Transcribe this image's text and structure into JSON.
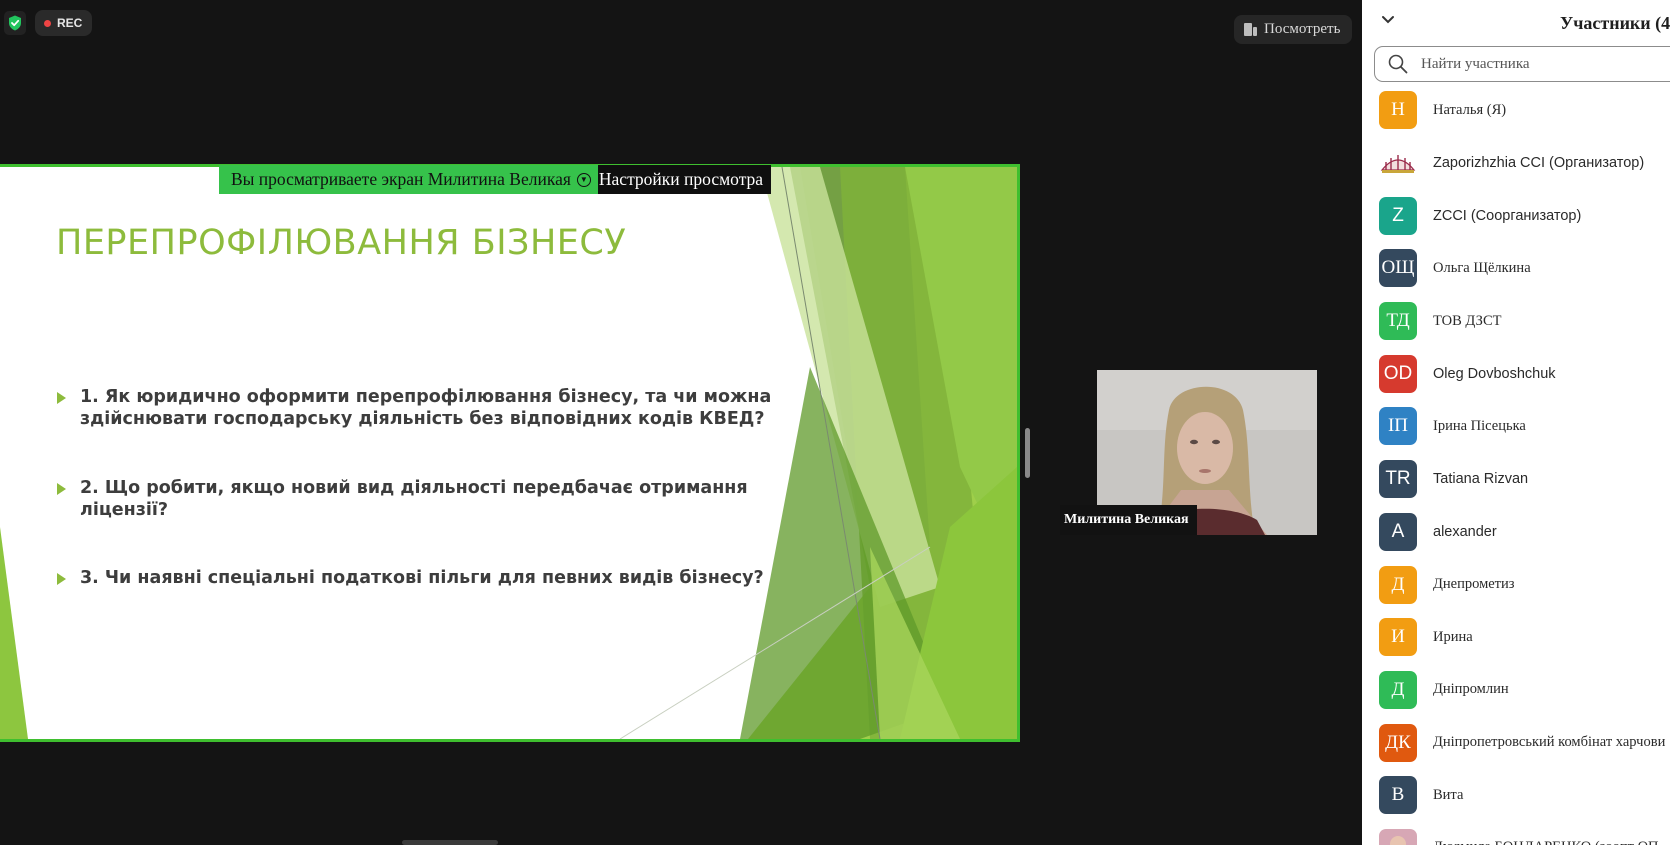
{
  "toolbar": {
    "rec_label": "REC",
    "view_label": "Посмотреть",
    "colors": {
      "security": "#22c55e",
      "rec_dot": "#ef4444"
    }
  },
  "share_banner": {
    "viewing_text": "Вы просматриваете экран Милитина Великая",
    "options_label": "Настройки просмотра"
  },
  "slide": {
    "title": "ПЕРЕПРОФІЛЮВАННЯ БІЗНЕСУ",
    "bullets": [
      {
        "line1": "1. Як юридично оформити перепрофілювання бізнесу, та чи можна",
        "line2": "здійснювати господарську діяльність без відповідних кодів КВЕД?"
      },
      {
        "line1": "2. Що робити, якщо новий вид діяльності передбачає отримання",
        "line2": "ліцензії?"
      },
      {
        "line1": "3. Чи наявні спеціальні податкові пільги для певних видів бізнесу?",
        "line2": ""
      }
    ],
    "colors": {
      "accent": "#8dbb3c",
      "text": "#3d3d3d"
    }
  },
  "video": {
    "name": "Милитина Великая"
  },
  "panel": {
    "title": "Участники (4",
    "search_placeholder": "Найти участника",
    "participants": [
      {
        "initials": "Н",
        "name": "Наталья (Я)",
        "color": "#f29d12",
        "font": "serif"
      },
      {
        "initials": "",
        "name": "Zaporizhzhia CCI (Организатор)",
        "color": "#ffffff",
        "font": "sans",
        "logo": "chamber-logo-icon"
      },
      {
        "initials": "Z",
        "name": "ZCCI (Соорганизатор)",
        "color": "#1aa58b",
        "font": "sans"
      },
      {
        "initials": "ОЩ",
        "name": "Ольга Щёлкина",
        "color": "#34495e",
        "font": "serif"
      },
      {
        "initials": "ТД",
        "name": "ТОВ ДЗСТ",
        "color": "#2fbb57",
        "font": "serif"
      },
      {
        "initials": "OD",
        "name": "Oleg Dovboshchuk",
        "color": "#d63a2e",
        "font": "sans"
      },
      {
        "initials": "ІП",
        "name": "Ірина Пісецька",
        "color": "#2f82c4",
        "font": "serif"
      },
      {
        "initials": "TR",
        "name": "Tatiana Rizvan",
        "color": "#34495e",
        "font": "sans"
      },
      {
        "initials": "A",
        "name": "alexander",
        "color": "#34495e",
        "font": "sans"
      },
      {
        "initials": "Д",
        "name": "Днепрометиз",
        "color": "#f29d12",
        "font": "serif"
      },
      {
        "initials": "И",
        "name": "Ирина",
        "color": "#f29d12",
        "font": "serif"
      },
      {
        "initials": "Д",
        "name": "Дніпромлин",
        "color": "#2fbb57",
        "font": "serif"
      },
      {
        "initials": "ДК",
        "name": "Дніпропетровський комбінат харчови",
        "color": "#e0590f",
        "font": "serif"
      },
      {
        "initials": "В",
        "name": "Вита",
        "color": "#34495e",
        "font": "serif"
      },
      {
        "initials": "",
        "name": "Людмила БОНДАРЕНКО (зоопт ОП",
        "color": "#ffffff",
        "font": "serif",
        "logo": "profile-photo-icon"
      }
    ]
  }
}
